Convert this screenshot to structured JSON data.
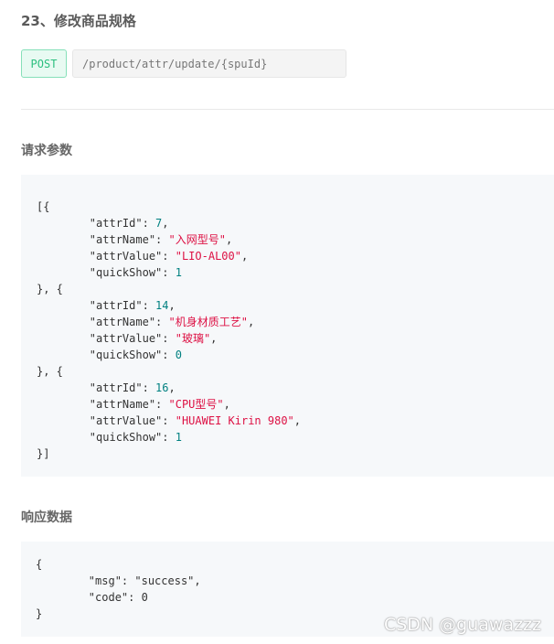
{
  "title": "23、修改商品规格",
  "method": "POST",
  "endpoint": "/product/attr/update/{spuId}",
  "request_section": {
    "title": "请求参数",
    "lines": [
      [
        {
          "t": "[{",
          "c": "plain"
        }
      ],
      [
        {
          "t": "        \"attrId\": ",
          "c": "key"
        },
        {
          "t": "7",
          "c": "num"
        },
        {
          "t": ",",
          "c": "plain"
        }
      ],
      [
        {
          "t": "        \"attrName\": ",
          "c": "key"
        },
        {
          "t": "\"入网型号\"",
          "c": "str"
        },
        {
          "t": ",",
          "c": "plain"
        }
      ],
      [
        {
          "t": "        \"attrValue\": ",
          "c": "key"
        },
        {
          "t": "\"LIO-AL00\"",
          "c": "str"
        },
        {
          "t": ",",
          "c": "plain"
        }
      ],
      [
        {
          "t": "        \"quickShow\": ",
          "c": "key"
        },
        {
          "t": "1",
          "c": "num"
        }
      ],
      [
        {
          "t": "}, {",
          "c": "plain"
        }
      ],
      [
        {
          "t": "        \"attrId\": ",
          "c": "key"
        },
        {
          "t": "14",
          "c": "num"
        },
        {
          "t": ",",
          "c": "plain"
        }
      ],
      [
        {
          "t": "        \"attrName\": ",
          "c": "key"
        },
        {
          "t": "\"机身材质工艺\"",
          "c": "str"
        },
        {
          "t": ",",
          "c": "plain"
        }
      ],
      [
        {
          "t": "        \"attrValue\": ",
          "c": "key"
        },
        {
          "t": "\"玻璃\"",
          "c": "str"
        },
        {
          "t": ",",
          "c": "plain"
        }
      ],
      [
        {
          "t": "        \"quickShow\": ",
          "c": "key"
        },
        {
          "t": "0",
          "c": "num"
        }
      ],
      [
        {
          "t": "}, {",
          "c": "plain"
        }
      ],
      [
        {
          "t": "        \"attrId\": ",
          "c": "key"
        },
        {
          "t": "16",
          "c": "num"
        },
        {
          "t": ",",
          "c": "plain"
        }
      ],
      [
        {
          "t": "        \"attrName\": ",
          "c": "key"
        },
        {
          "t": "\"CPU型号\"",
          "c": "str"
        },
        {
          "t": ",",
          "c": "plain"
        }
      ],
      [
        {
          "t": "        \"attrValue\": ",
          "c": "key"
        },
        {
          "t": "\"HUAWEI Kirin 980\"",
          "c": "str"
        },
        {
          "t": ",",
          "c": "plain"
        }
      ],
      [
        {
          "t": "        \"quickShow\": ",
          "c": "key"
        },
        {
          "t": "1",
          "c": "num"
        }
      ],
      [
        {
          "t": "}]",
          "c": "plain"
        }
      ]
    ]
  },
  "response_section": {
    "title": "响应数据",
    "lines": [
      [
        {
          "t": "{",
          "c": "plain"
        }
      ],
      [
        {
          "t": "        \"msg\": \"success\",",
          "c": "plain"
        }
      ],
      [
        {
          "t": "        \"code\": 0",
          "c": "plain"
        }
      ],
      [
        {
          "t": "}",
          "c": "plain"
        }
      ]
    ]
  },
  "watermark": "CSDN @guawazzz",
  "colors": {
    "method_text": "#2bbf7f",
    "method_bg": "#e8faf2",
    "string": "#d14",
    "number": "#008080",
    "code_bg": "#f6f8fa"
  }
}
